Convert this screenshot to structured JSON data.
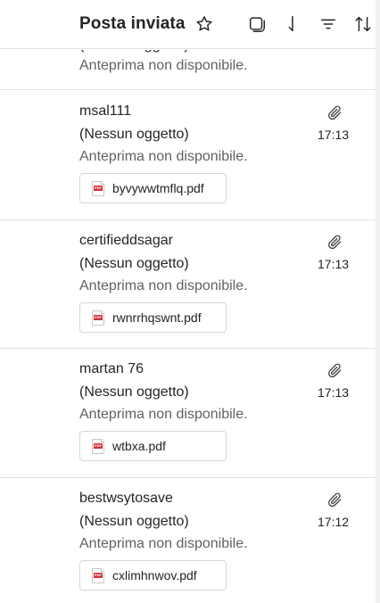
{
  "header": {
    "title": "Posta inviata",
    "icons": [
      "star-icon",
      "select-all-icon",
      "sort-down-icon",
      "filter-icon",
      "sort-icon"
    ]
  },
  "partial_message": {
    "subject": "(Nessun oggetto)",
    "preview": "Anteprima non disponibile."
  },
  "messages": [
    {
      "sender": "msal111",
      "subject": "(Nessun oggetto)",
      "preview": "Anteprima non disponibile.",
      "time": "17:13",
      "attachment": "byvywwtmflq.pdf"
    },
    {
      "sender": "certifieddsagar",
      "subject": "(Nessun oggetto)",
      "preview": "Anteprima non disponibile.",
      "time": "17:13",
      "attachment": "rwnrrhqswnt.pdf"
    },
    {
      "sender": "martan 76",
      "subject": "(Nessun oggetto)",
      "preview": "Anteprima non disponibile.",
      "time": "17:13",
      "attachment": "wtbxa.pdf"
    },
    {
      "sender": "bestwsytosave",
      "subject": "(Nessun oggetto)",
      "preview": "Anteprima non disponibile.",
      "time": "17:12",
      "attachment": "cxlimhnwov.pdf"
    }
  ],
  "colors": {
    "text": "#242424",
    "preview_text": "#616161",
    "divider": "#e1e1e1",
    "pdf_red": "#d13438"
  }
}
